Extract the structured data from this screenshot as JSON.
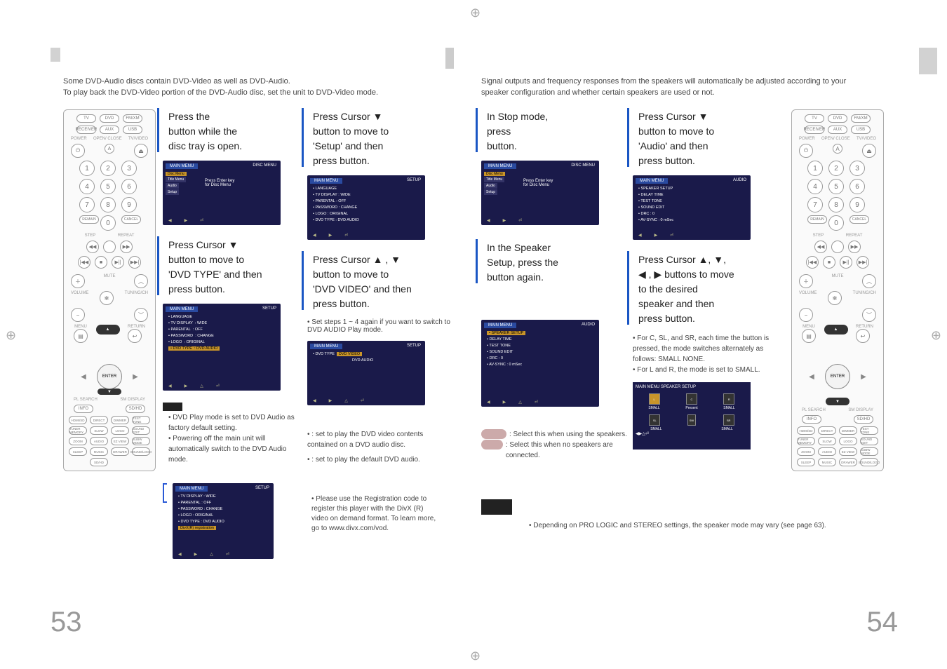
{
  "crop_glyph": "⊕",
  "page_left": {
    "intro_line1": "Some DVD-Audio discs contain DVD-Video as well as DVD-Audio.",
    "intro_line2": "To play back the DVD-Video portion of the DVD-Audio disc, set the unit to DVD-Video mode.",
    "step1": {
      "line1": "Press the",
      "line2": "button while the",
      "line3": "disc tray is open."
    },
    "step2": {
      "line1": "Press Cursor ▼",
      "line2": "button to move to",
      "line3": "'Setup' and then",
      "line4": "press         button."
    },
    "step3": {
      "line1": "Press Cursor  ▼",
      "line2": "button to move to",
      "line3": "'DVD TYPE' and then",
      "line4": "press         button."
    },
    "step4": {
      "line1": "Press Cursor ▲ , ▼",
      "line2": "button to move to",
      "line3": "'DVD VIDEO' and then",
      "line4": "press         button."
    },
    "step4_note": "• Set steps 1 ~ 4 again if you want to switch to DVD AUDIO Play mode.",
    "notes": {
      "b1": "• DVD Play mode is set to DVD Audio as factory default setting.",
      "b2": "• Powering off the main unit will automatically switch to the DVD Audio mode."
    },
    "subnotes": {
      "b1a": "•               : set to play the DVD video contents contained on a DVD audio disc.",
      "b1b": "•               : set to play the default DVD audio."
    },
    "divx_note": "• Please use the Registration code to register this player with the DivX (R) video on demand format. To learn more, go to www.divx.com/vod.",
    "page_number": "53"
  },
  "screens": {
    "disc_menu_hdr": "MAIN MENU",
    "disc_menu_r": "DISC MENU",
    "setup_r": "SETUP",
    "audio_r": "AUDIO",
    "speaker_setup_r": "SPEAKER SETUP",
    "press_enter": "Press Enter key",
    "for_disc_menu": "for Disc Menu",
    "tabs": [
      "Disc Menu",
      "Title Menu",
      "Audio",
      "Setup"
    ],
    "tabs_audio": [
      "Disc Menu",
      "Title Menu",
      "Audio",
      "Setup"
    ],
    "setup_items": [
      {
        "label": "LANGUAGE",
        "val": ""
      },
      {
        "label": "TV DISPLAY",
        "val": ": WIDE"
      },
      {
        "label": "PARENTAL",
        "val": ": OFF"
      },
      {
        "label": "PASSWORD",
        "val": ": CHANGE"
      },
      {
        "label": "LOGO",
        "val": ": ORIGINAL"
      },
      {
        "label": "DVD TYPE",
        "val": ": DVD AUDIO"
      }
    ],
    "dvdtype_options": [
      "DVD VIDEO",
      "DVD AUDIO"
    ],
    "divx_item": "DivX(R) registration",
    "audio_items": [
      {
        "label": "SPEAKER SETUP",
        "val": ""
      },
      {
        "label": "DELAY TIME",
        "val": ""
      },
      {
        "label": "TEST TONE",
        "val": ""
      },
      {
        "label": "SOUND EDIT",
        "val": ""
      },
      {
        "label": "DRC",
        "val": ": 0"
      },
      {
        "label": "AV-SYNC",
        "val": ": 0 mSec"
      }
    ],
    "sp_labels": {
      "small": "SMALL",
      "present": "Present",
      "none": "NONE"
    }
  },
  "remote": {
    "top_row": [
      "TV",
      "DVD",
      "FM/XM"
    ],
    "top_row2": [
      "RECEIVER",
      "AUX",
      "USB"
    ],
    "labels": {
      "power": "POWER",
      "open": "OPEN/\nCLOSE",
      "tvvideo": "TV/VIDEO"
    },
    "icons": {
      "power": "⏻",
      "a": "A",
      "eject": "⏏"
    },
    "numpad": [
      "1",
      "2",
      "3",
      "4",
      "5",
      "6",
      "7",
      "8",
      "9",
      "REMAIN",
      "0",
      "CANCEL"
    ],
    "step_repeat": {
      "step": "STEP",
      "repeat": "REPEAT"
    },
    "transport": [
      "◀◀",
      "",
      "▶▶"
    ],
    "transport2": [
      "|◀◀",
      "■",
      "▶||",
      "▶▶|"
    ],
    "vol": {
      "plus": "＋",
      "mute": "MUTE",
      "tuning": "TUNING/CH",
      "minus": "−",
      "up": "︿",
      "down": "﹀",
      "ok": "✻"
    },
    "volume_label": "VOLUME",
    "menu": "MENU",
    "return": "RETURN",
    "menu_icon": "▤",
    "return_icon": "↩",
    "enter": "ENTER",
    "arrows": {
      "up": "▲",
      "down": "▼",
      "left": "◀",
      "right": "▶"
    },
    "info": "INFO",
    "mark": "SD/HD",
    "pl_search": "PL SEARCH",
    "sm_display": "SM DISPLAY",
    "bottom_grid": [
      "HDMI/SD",
      "DIRECT",
      "DIMMER",
      "TEST TONE",
      "TUNER MEMORY",
      "SLOW",
      "LOGO",
      "SOUND EDIT",
      "ZOOM",
      "AUDIO",
      "EZ VIEW",
      "SUBW MODE",
      "SLEEP",
      "MUSIC",
      "DRAWER",
      "SOUND/LOGO",
      "",
      "SD/HD",
      "",
      ""
    ]
  },
  "page_right": {
    "intro_line1": "Signal outputs and frequency responses from the speakers will automatically be adjusted according to your",
    "intro_line2": "speaker configuration and whether certain speakers are used or not.",
    "step1": {
      "line1": "In Stop mode,",
      "line2": "press",
      "line3": "button."
    },
    "step2": {
      "line1": "Press Cursor  ▼",
      "line2": "button to move to",
      "line3": "'Audio' and then",
      "line4": "press         button."
    },
    "step3": {
      "line1": "In the Speaker",
      "line2": "Setup, press the",
      "line3": "        button again."
    },
    "step4": {
      "line1": "Press Cursor  ▲,  ▼,",
      "line2": "◀ , ▶ buttons to move",
      "line3": "to the desired",
      "line4": "speaker and then",
      "line5": "press         button."
    },
    "step4_bullets": {
      "b1": "• For C, SL, and SR, each time the button is pressed, the mode switches alternately as follows: SMALL     NONE.",
      "b2": "• For L and R, the mode is set to SMALL."
    },
    "select_notes": {
      "a": ": Select this when using the speakers.",
      "b": ": Select this when no speakers are connected."
    },
    "final_note": "• Depending on PRO LOGIC and STEREO settings, the speaker mode may vary (see page 63).",
    "page_number": "54"
  }
}
